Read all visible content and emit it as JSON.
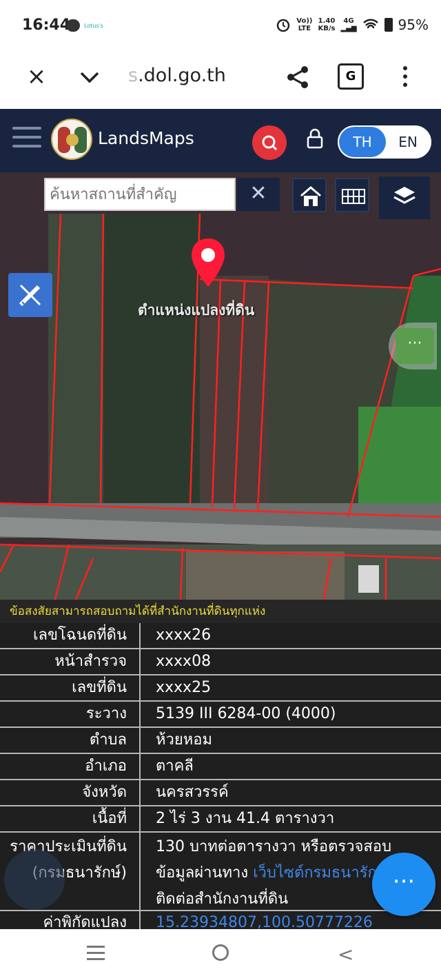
{
  "status_bar": {
    "time": "16:44",
    "notification_label": "Lotus's",
    "net_line1": "Vo))",
    "net_line2": "LTE",
    "speed_line1": "1.40",
    "speed_line2": "KB/s",
    "network_type": "4G",
    "battery": "95%"
  },
  "browser": {
    "url_faded": "s",
    "url": ".dol.go.th",
    "translate_label": "G"
  },
  "header": {
    "brand": "LandsMaps",
    "lang_th": "TH",
    "lang_en": "EN"
  },
  "map": {
    "search_placeholder": "ค้นหาสถานที่สำคัญ",
    "clear_symbol": "✕",
    "pin_label": "ตำแหน่งแปลงที่ดิน",
    "side_more_symbol": "···"
  },
  "info": {
    "notice": "ข้อสงสัยสามารถสอบถามได้ที่สำนักงานที่ดินทุกแห่ง",
    "rows": [
      {
        "label": "เลขโฉนดที่ดิน",
        "value": "xxxx26"
      },
      {
        "label": "หน้าสำรวจ",
        "value": "xxxx08"
      },
      {
        "label": "เลขที่ดิน",
        "value": "xxxx25"
      },
      {
        "label": "ระวาง",
        "value": "5139 III 6284-00 (4000)"
      },
      {
        "label": "ตำบล",
        "value": "ห้วยหอม"
      },
      {
        "label": "อำเภอ",
        "value": "ตาคลี"
      },
      {
        "label": "จังหวัด",
        "value": "นครสวรรค์"
      },
      {
        "label": "เนื้อที่",
        "value": "2 ไร่ 3 งาน 41.4 ตารางวา"
      }
    ],
    "price_label_1": "ราคาประเมินที่ดิน",
    "price_label_2": "(กรมธนารักษ์)",
    "price_line1": "130 บาทต่อตารางวา หรือตรวจสอบ",
    "price_line2_prefix": "ข้อมูลผ่านทาง ",
    "price_link": "เว็บไซต์กรมธนารักษ์",
    "price_line3": "ติดต่อสำนักงานที่ดิน",
    "coord_label": "ค่าพิกัดแปลง",
    "coord_value": "15.23934807,100.50777226",
    "fab_symbol": "···"
  }
}
